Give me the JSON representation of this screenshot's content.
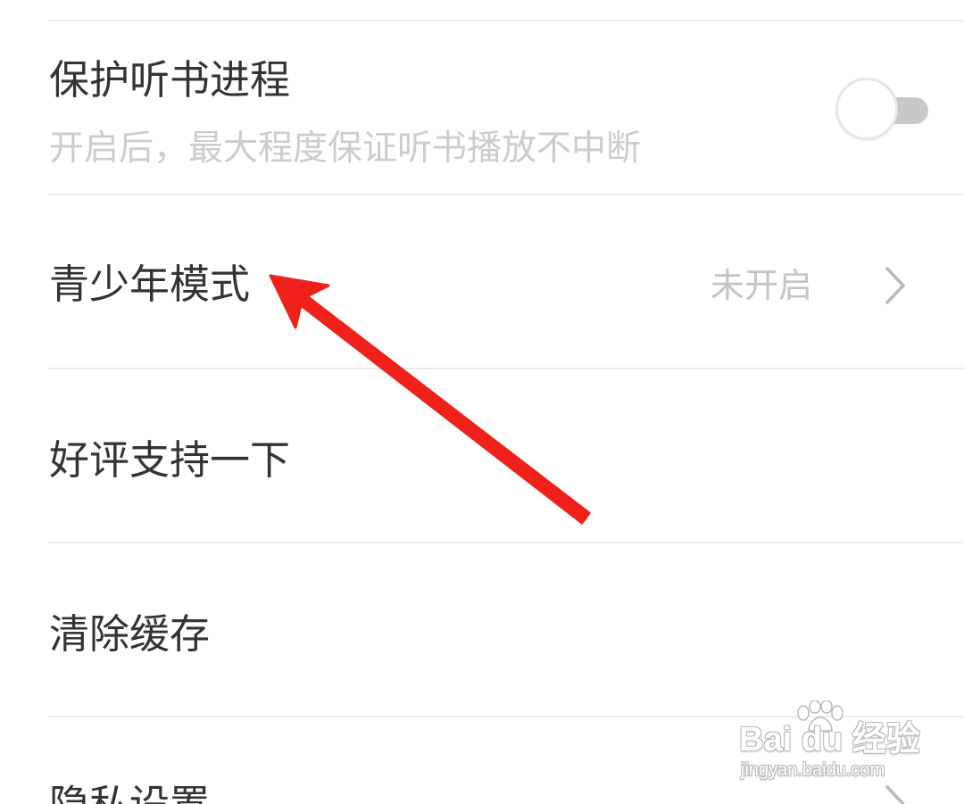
{
  "settings": {
    "protect_listening": {
      "title": "保护听书进程",
      "subtitle": "开启后，最大程度保证听书播放不中断",
      "toggle_on": false
    },
    "teen_mode": {
      "title": "青少年模式",
      "value": "未开启"
    },
    "rate_us": {
      "title": "好评支持一下"
    },
    "clear_cache": {
      "title": "清除缓存"
    },
    "privacy": {
      "title": "隐私设置"
    }
  },
  "annotation": {
    "arrow_color": "#f0201a"
  },
  "watermark": {
    "brand": "Bai du 经验",
    "url": "jingyan.baidu.com"
  },
  "icons": {
    "chevron": "chevron-right-icon",
    "paw": "baidu-paw-icon"
  },
  "colors": {
    "title": "#333333",
    "subtitle": "#cccccc",
    "value": "#c4c4c4",
    "divider": "#ececec",
    "toggle_off_track": "#c8c8c8"
  }
}
